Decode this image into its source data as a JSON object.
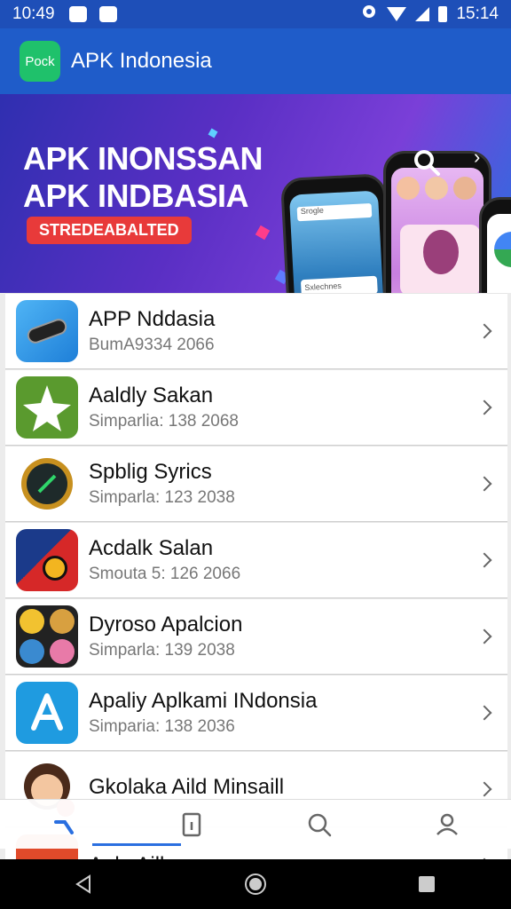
{
  "status_bar": {
    "time_left": "10:49",
    "time_right": "15:14"
  },
  "app_bar": {
    "logo_text": "Pock",
    "title": "APK Indonesia"
  },
  "banner": {
    "line1": "APK INONSSAN",
    "line2": "APK INDBASIA",
    "badge": "STREDEABALTED",
    "phone_search_1": "Srogle",
    "phone_search_2": "Sxlechnes"
  },
  "apps": [
    {
      "name": "APP Nddasia",
      "sub": "BumA9334 2066",
      "icon": "battery-app-icon"
    },
    {
      "name": "Aaldly Sakan",
      "sub": "Simparlіa: 138 2068",
      "icon": "star-app-icon"
    },
    {
      "name": "Spblig Syrics",
      "sub": "Simparla: 123 2038",
      "icon": "clock-app-icon"
    },
    {
      "name": "Acdalk Salan",
      "sub": "Smouta 5: 126 2066",
      "icon": "game-app-icon"
    },
    {
      "name": "Dyroso Apalcion",
      "sub": "Simparla: 139 2038",
      "icon": "collage-app-icon"
    },
    {
      "name": "Apaliy Aplkami INdonsia",
      "sub": "Simparia: 138 2036",
      "icon": "a-logo-app-icon"
    },
    {
      "name": "Gkolaka Aild Minsaill",
      "sub": "",
      "icon": "avatar-app-icon"
    },
    {
      "name": "Aaln Ailla",
      "sub": "",
      "icon": "red-app-icon"
    }
  ],
  "bottom_nav": [
    {
      "name": "home",
      "icon": "hammer-icon",
      "selected": true
    },
    {
      "name": "apps",
      "icon": "document-icon",
      "selected": false
    },
    {
      "name": "search",
      "icon": "search-icon",
      "selected": false
    },
    {
      "name": "profile",
      "icon": "person-icon",
      "selected": false
    }
  ],
  "colors": {
    "app_bar": "#1f5cc9",
    "accent": "#2a6fe0",
    "badge": "#e83a3a"
  }
}
